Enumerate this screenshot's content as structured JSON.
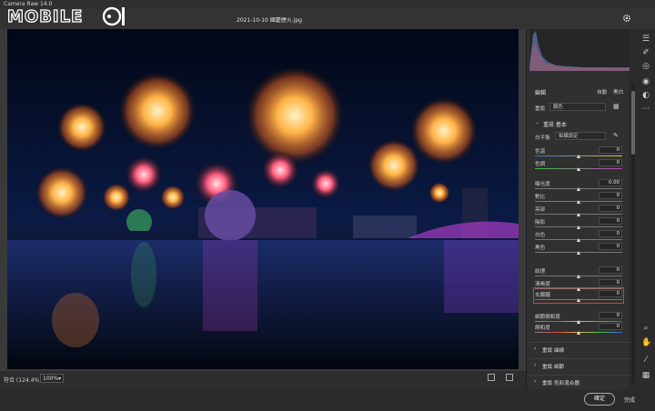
{
  "window": {
    "title": "Camera Raw 14.0",
    "controls": [
      "–",
      "□",
      "×"
    ]
  },
  "logo": {
    "text": "MOBILE"
  },
  "file": {
    "name": "2021-10-10 國慶煙火.jpg"
  },
  "status": {
    "zoom_label": "符合 (124.4%)",
    "zoom_value": "100%"
  },
  "buttons": {
    "ok": "確定",
    "done": "完成"
  },
  "panel": {
    "edit_title": "編輯",
    "auto": "自動",
    "bw": "黑白",
    "profile_label": "重設",
    "profile_value": "顏色",
    "basic_title": "重設 基本",
    "wb_label": "白平衡",
    "wb_value": "拍攝設定",
    "sliders": [
      {
        "name": "temp",
        "label": "色溫",
        "value": "0",
        "pos": 0.5
      },
      {
        "name": "tint",
        "label": "色調",
        "value": "0",
        "pos": 0.5
      },
      {
        "name": "exposure",
        "label": "曝光度",
        "value": "0.00",
        "pos": 0.5
      },
      {
        "name": "contrast",
        "label": "對比",
        "value": "0",
        "pos": 0.5
      },
      {
        "name": "highlights",
        "label": "亮部",
        "value": "0",
        "pos": 0.5
      },
      {
        "name": "shadows",
        "label": "陰影",
        "value": "0",
        "pos": 0.5
      },
      {
        "name": "whites",
        "label": "白色",
        "value": "0",
        "pos": 0.5
      },
      {
        "name": "blacks",
        "label": "黑色",
        "value": "0",
        "pos": 0.5
      },
      {
        "name": "texture",
        "label": "紋理",
        "value": "0",
        "pos": 0.5
      },
      {
        "name": "clarity",
        "label": "清晰度",
        "value": "0",
        "pos": 0.5
      },
      {
        "name": "dehaze",
        "label": "去朦朧",
        "value": "0",
        "pos": 0.5
      },
      {
        "name": "vibrance",
        "label": "細節飽和度",
        "value": "0",
        "pos": 0.5
      },
      {
        "name": "saturation",
        "label": "飽和度",
        "value": "0",
        "pos": 0.5
      }
    ],
    "sections": [
      "重設 曲線",
      "重設 細節",
      "重設 色彩混合器"
    ]
  },
  "colors": {
    "highlight_border": "#e53935",
    "sky": "#0a1030"
  }
}
